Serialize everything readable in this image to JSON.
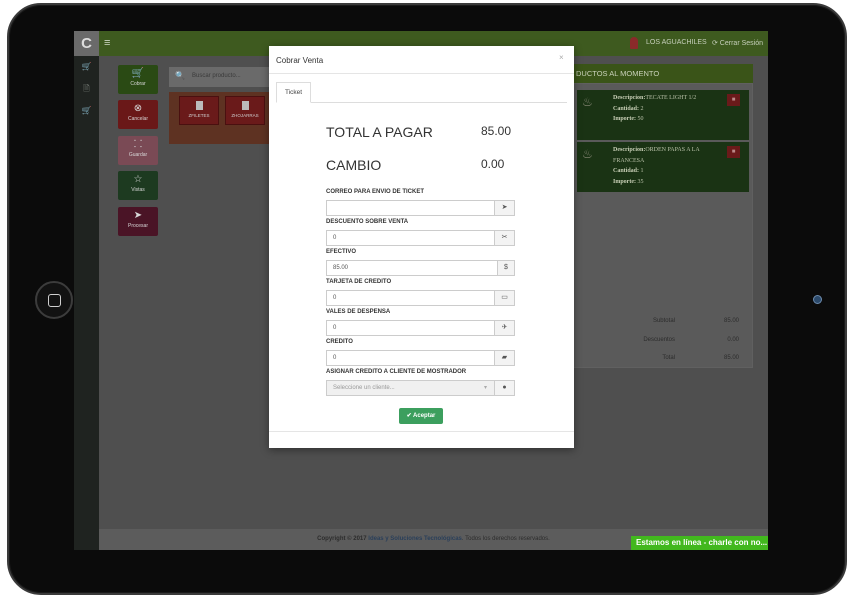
{
  "colors": {
    "accent_green": "#3c9f5e",
    "topbar": "#3e5a1f",
    "chat": "#42b81e"
  },
  "topbar": {
    "logo": "C",
    "menu_icon": "≡",
    "user_name": "LOS AGUACHILES",
    "logout": "⟳ Cerrar Sesión"
  },
  "sidebar": {
    "icons": [
      "cart-icon",
      "document-icon",
      "cart-icon"
    ]
  },
  "actions": [
    {
      "label": "Cobrar",
      "icon": "cart-icon"
    },
    {
      "label": "Cancelar",
      "icon": "cancel-icon"
    },
    {
      "label": "Guardar",
      "icon": "sitemap-icon"
    },
    {
      "label": "Vistas",
      "icon": "star-icon"
    },
    {
      "label": "Procesar",
      "icon": "send-icon"
    }
  ],
  "search": {
    "placeholder": "Buscar producto..."
  },
  "products": [
    {
      "name": "ZFILETES"
    },
    {
      "name": "ZHOJARRAS"
    }
  ],
  "order_panel": {
    "header": "DUCTOS AL MOMENTO",
    "items": [
      {
        "desc_label": "Descripcion:",
        "desc": "TECATE LIGHT 1/2",
        "qty_label": "Cantidad:",
        "qty": "2",
        "amount_label": "Importe:",
        "amount": "50"
      },
      {
        "desc_label": "Descripcion:",
        "desc": "ORDEN PAPAS A LA FRANCESA",
        "qty_label": "Cantidad:",
        "qty": "1",
        "amount_label": "Importe:",
        "amount": "35"
      }
    ],
    "totals": [
      {
        "label": "Subtotal",
        "value": "85.00"
      },
      {
        "label": "Descuentos",
        "value": "0.00"
      },
      {
        "label": "Total",
        "value": "85.00"
      }
    ]
  },
  "footer": {
    "prefix": "Copyright © 2017",
    "brand": "Ideas y Soluciones Tecnológicas",
    "suffix": ". Todos los derechos reservados."
  },
  "chat": {
    "label": "Estamos en línea - charle con no..."
  },
  "modal": {
    "title": "Cobrar Venta",
    "close": "×",
    "tab": "Ticket",
    "total_label": "TOTAL A PAGAR",
    "total_value": "85.00",
    "change_label": "CAMBIO",
    "change_value": "0.00",
    "fields": [
      {
        "label": "CORREO PARA ENVIO DE TICKET",
        "value": "",
        "icon": "send-icon",
        "glyph": "➤"
      },
      {
        "label": "DESCUENTO SOBRE VENTA",
        "value": "0",
        "icon": "scissors-icon",
        "glyph": "✂"
      },
      {
        "label": "EFECTIVO",
        "value": "85.00",
        "icon": "dollar-icon",
        "glyph": "$"
      },
      {
        "label": "TARJETA DE CREDITO",
        "value": "0",
        "icon": "card-icon",
        "glyph": "▭"
      },
      {
        "label": "VALES DE DESPENSA",
        "value": "0",
        "icon": "plane-icon",
        "glyph": "✈"
      },
      {
        "label": "CREDITO",
        "value": "0",
        "icon": "folder-icon",
        "glyph": "▰"
      }
    ],
    "client_label": "ASIGNAR CREDITO A CLIENTE DE MOSTRADOR",
    "client_placeholder": "Seleccione un cliente...",
    "client_icon_glyph": "●",
    "accept": "✔ Aceptar"
  }
}
